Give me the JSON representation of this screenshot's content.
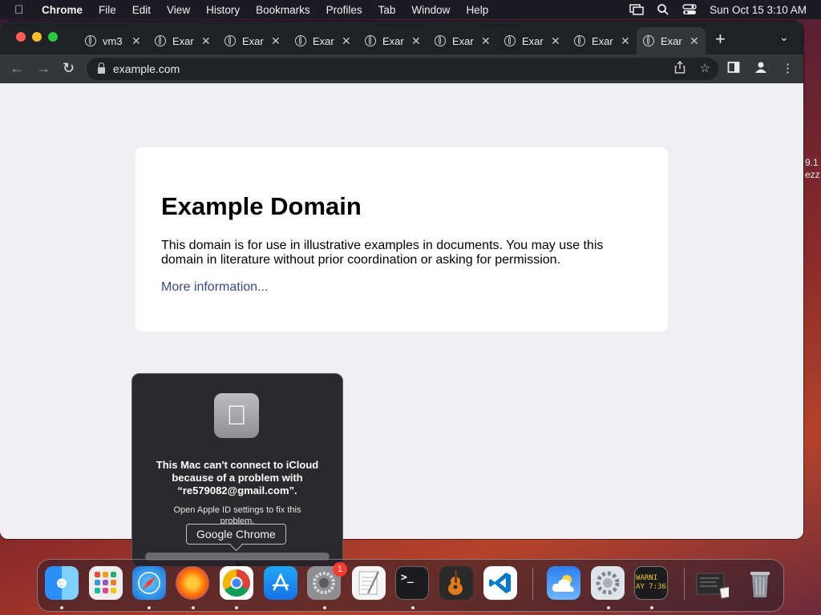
{
  "menubar": {
    "app": "Chrome",
    "items": [
      "File",
      "Edit",
      "View",
      "History",
      "Bookmarks",
      "Profiles",
      "Tab",
      "Window",
      "Help"
    ],
    "clock": "Sun Oct 15  3:10 AM"
  },
  "tabs": [
    {
      "label": "vm3"
    },
    {
      "label": "Exar"
    },
    {
      "label": "Exar"
    },
    {
      "label": "Exar"
    },
    {
      "label": "Exar"
    },
    {
      "label": "Exar"
    },
    {
      "label": "Exar"
    },
    {
      "label": "Exar"
    },
    {
      "label": "Exar"
    }
  ],
  "address": {
    "url": "example.com"
  },
  "page": {
    "title": "Example Domain",
    "body": "This domain is for use in illustrative examples in documents. You may use this domain in literature without prior coordination or asking for permission.",
    "link": "More information..."
  },
  "dialog": {
    "title": "This Mac can't connect to iCloud because of a problem with “re579082@gmail.com”.",
    "message": "Open Apple ID settings to fix this problem."
  },
  "tooltip": "Google Chrome",
  "peek": {
    "line1": "9.1",
    "line2": "ezz"
  },
  "dock": {
    "badge_count": "1",
    "console_text": "WARNI\nAY 7:36",
    "icons": [
      "finder-icon",
      "launchpad-icon",
      "safari-icon",
      "firefox-icon",
      "chrome-icon",
      "app-store-icon",
      "system-settings-icon",
      "textedit-icon",
      "terminal-icon",
      "garageband-icon",
      "vscode-icon",
      "weather-icon",
      "settings-app-icon",
      "console-icon",
      "downloads-stack-icon",
      "trash-icon"
    ]
  },
  "colors": {
    "accent_link": "#38488f",
    "tabbar": "#202124",
    "toolbar": "#35363a"
  }
}
